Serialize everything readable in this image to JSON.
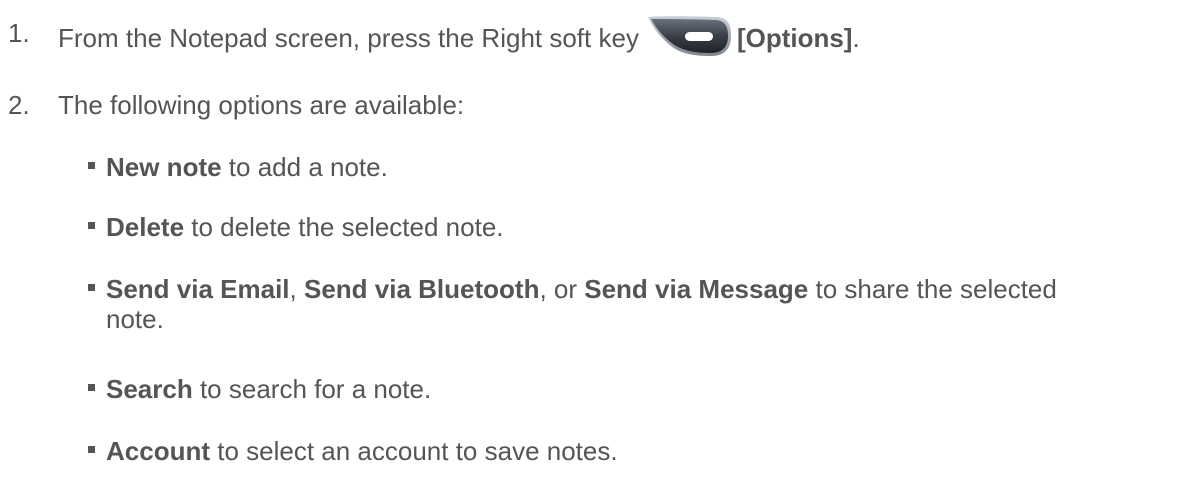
{
  "step1": {
    "number": "1.",
    "text_before": "From the Notepad screen, press the Right soft key",
    "key_icon": "right-soft-key-icon",
    "option_label": "[Options]",
    "text_after": "."
  },
  "step2": {
    "number": "2.",
    "text": "The following options are available:"
  },
  "options": [
    {
      "bold": "New note",
      "rest": " to add a note."
    },
    {
      "bold": "Delete",
      "rest": " to delete the selected note."
    },
    {
      "bold_a": "Send via Email",
      "sep1": ", ",
      "bold_b": "Send via Bluetooth",
      "sep2": ", or ",
      "bold_c": "Send via Message",
      "rest": " to share the selected",
      "rest_line2": "note."
    },
    {
      "bold": "Search",
      "rest": " to search for a note."
    },
    {
      "bold": "Account",
      "rest": " to select an account to save notes."
    }
  ],
  "colors": {
    "text": "#555555",
    "key_body": "#3a3f47",
    "key_highlight": "#ffffff"
  }
}
